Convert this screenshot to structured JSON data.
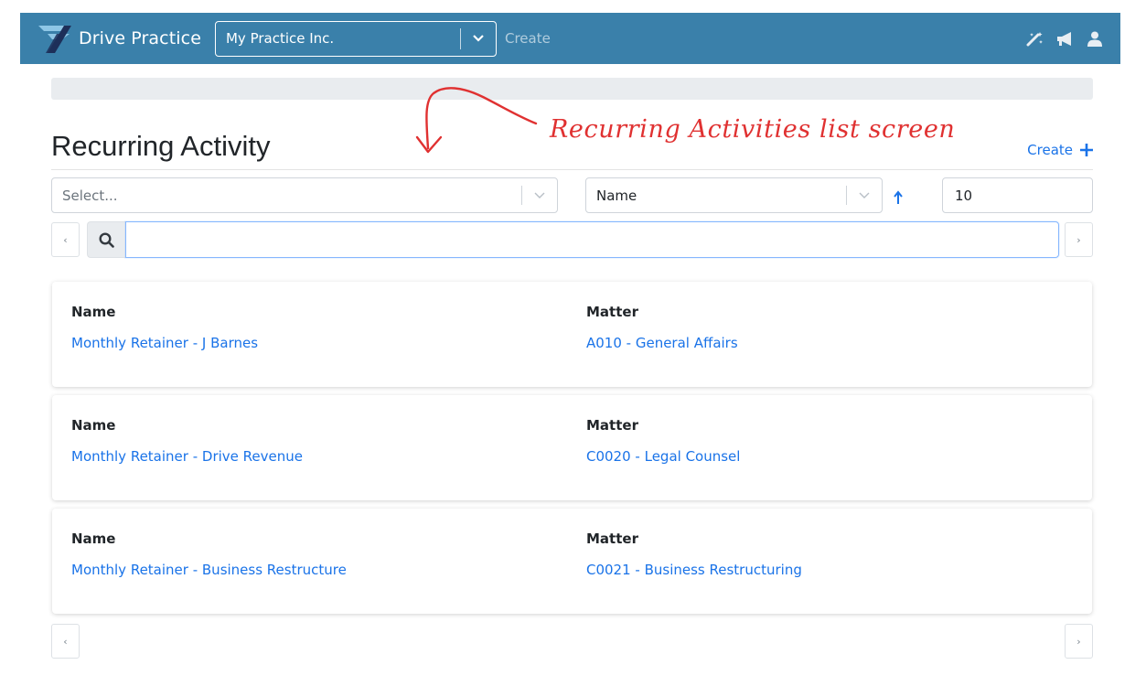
{
  "navbar": {
    "brand": "Drive Practice",
    "practice_value": "My Practice Inc.",
    "create_label": "Create",
    "icons": [
      "magic-wand-icon",
      "megaphone-icon",
      "user-icon"
    ],
    "bg_color": "#3a80aa"
  },
  "page": {
    "title": "Recurring Activity",
    "create_label": "Create",
    "annotation": "Recurring Activities list screen"
  },
  "filters": {
    "select_placeholder": "Select...",
    "sort_value": "Name",
    "page_size": "10"
  },
  "search": {
    "value": ""
  },
  "records": [
    {
      "name_label": "Name",
      "name": "Monthly Retainer - J Barnes",
      "matter_label": "Matter",
      "matter": "A010 - General Affairs"
    },
    {
      "name_label": "Name",
      "name": "Monthly Retainer - Drive Revenue",
      "matter_label": "Matter",
      "matter": "C0020 - Legal Counsel"
    },
    {
      "name_label": "Name",
      "name": "Monthly Retainer - Business Restructure",
      "matter_label": "Matter",
      "matter": "C0021 - Business Restructuring"
    }
  ],
  "pager": {
    "prev": "‹",
    "next": "›"
  },
  "colors": {
    "link": "#1a73e8",
    "annotation": "#e03131"
  }
}
